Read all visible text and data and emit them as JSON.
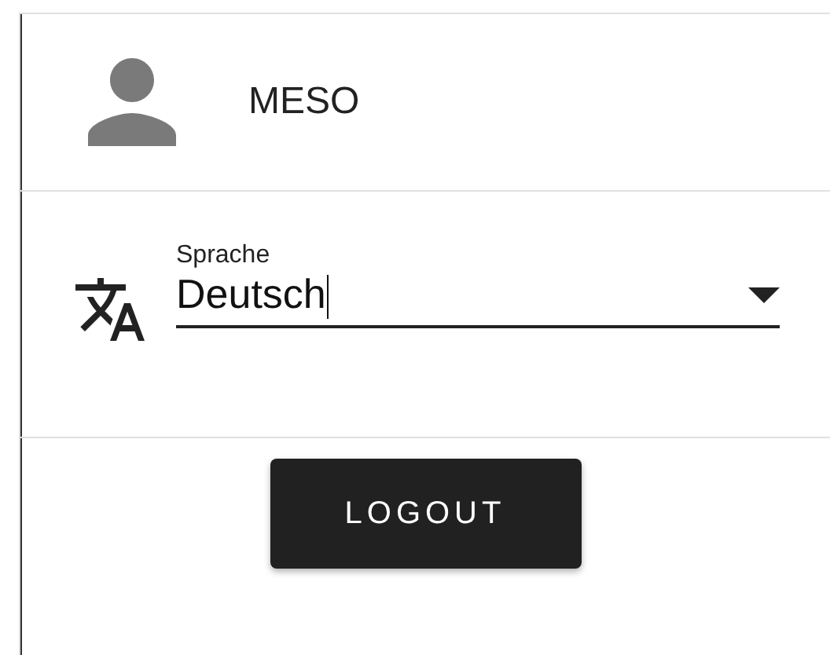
{
  "user": {
    "name": "MESO"
  },
  "language": {
    "label": "Sprache",
    "value": "Deutsch",
    "focused": true
  },
  "buttons": [
    {
      "label": "LOGOUT"
    }
  ]
}
